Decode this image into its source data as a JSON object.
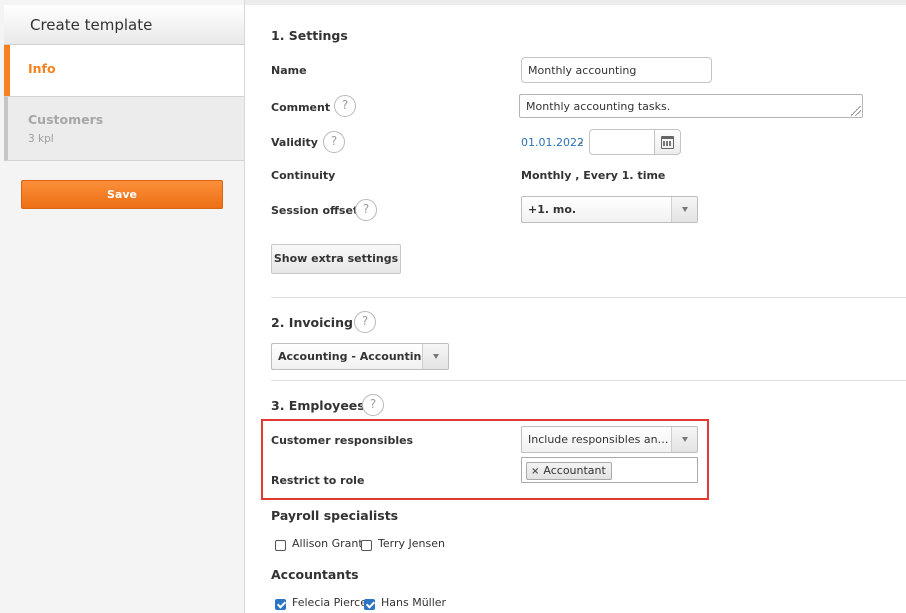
{
  "sidebar": {
    "title": "Create template",
    "tabs": [
      {
        "label": "Info",
        "active": true
      },
      {
        "label": "Customers",
        "sub": "3 kpl",
        "active": false
      }
    ],
    "save_label": "Save"
  },
  "settings": {
    "heading": "1. Settings",
    "name_label": "Name",
    "name_value": "Monthly accounting",
    "comment_label": "Comment",
    "comment_value": "Monthly accounting tasks.",
    "validity_label": "Validity",
    "validity_start": "01.01.2022",
    "validity_sep": "-",
    "validity_end": "",
    "continuity_label": "Continuity",
    "continuity_value": "Monthly , Every 1. time",
    "session_offset_label": "Session offset",
    "session_offset_value": "+1. mo.",
    "extra_button": "Show extra settings",
    "help_glyph": "?"
  },
  "invoicing": {
    "heading": "2. Invoicing",
    "selected": "Accounting - Accounting"
  },
  "employees": {
    "heading": "3. Employees",
    "customer_responsibles_label": "Customer responsibles",
    "customer_responsibles_value": "Include responsibles and d...",
    "restrict_role_label": "Restrict to role",
    "role_chip": "Accountant",
    "chip_remove": "×",
    "payroll_heading": "Payroll specialists",
    "payroll": [
      {
        "name": "Allison Grant",
        "checked": false
      },
      {
        "name": "Terry Jensen",
        "checked": false
      }
    ],
    "accountants_heading": "Accountants",
    "accountants": [
      {
        "name": "Felecia Pierce",
        "checked": true
      },
      {
        "name": "Hans Müller",
        "checked": true
      }
    ]
  },
  "colors": {
    "accent": "#f5821f",
    "link": "#2b73b5",
    "highlight_border": "#e03b30",
    "checkbox_checked": "#2c74c4"
  }
}
